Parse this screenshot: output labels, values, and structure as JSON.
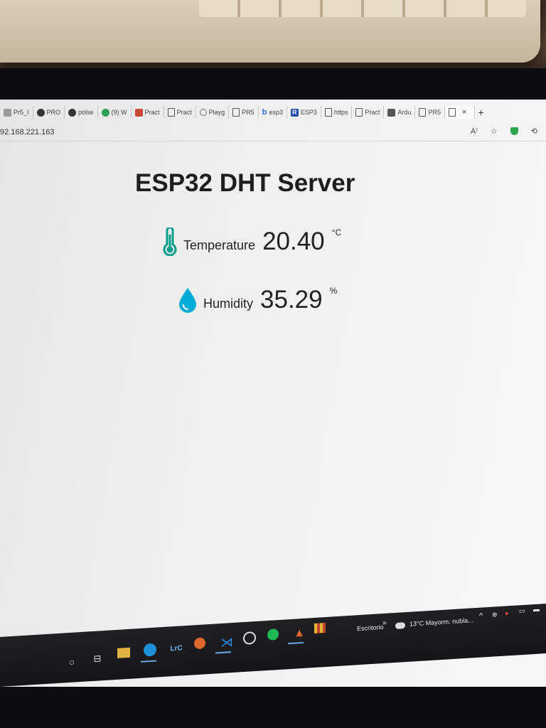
{
  "browser": {
    "tabs": [
      {
        "label": "Pr5_I",
        "favicon": "globe-icon"
      },
      {
        "label": "PRO",
        "favicon": "github-icon"
      },
      {
        "label": "polse",
        "favicon": "github-icon"
      },
      {
        "label": "(9) W",
        "favicon": "whatsapp-icon"
      },
      {
        "label": "Pract",
        "favicon": "pdf-icon"
      },
      {
        "label": "Pract",
        "favicon": "document-icon"
      },
      {
        "label": "Playg",
        "favicon": "openai-icon"
      },
      {
        "label": "PR5",
        "favicon": "document-icon"
      },
      {
        "label": "esp3",
        "favicon": "bing-icon"
      },
      {
        "label": "ESP3",
        "favicon": "r-icon"
      },
      {
        "label": "https",
        "favicon": "document-icon"
      },
      {
        "label": "Pract",
        "favicon": "document-icon"
      },
      {
        "label": "Ardu",
        "favicon": "arduino-icon"
      },
      {
        "label": "PR5",
        "favicon": "document-icon"
      }
    ],
    "close_glyph": "×",
    "new_tab_glyph": "+",
    "url": "92.168.221.163",
    "read_aloud_glyph": "A⁾",
    "favorites_glyph": "☆",
    "extension_glyph": "⟲"
  },
  "page": {
    "title": "ESP32 DHT Server",
    "accent_temperature": "#059e8a",
    "accent_humidity": "#00add6",
    "readings": {
      "temperature": {
        "label": "Temperature",
        "value": "20.40",
        "unit": "°C"
      },
      "humidity": {
        "label": "Humidity",
        "value": "35.29",
        "unit": "%"
      }
    }
  },
  "taskbar": {
    "desktop_label": "Escritorio",
    "desktop_chevron": "»",
    "weather": "13°C Mayorm. nubla...",
    "apps": [
      "start-icon",
      "task-view-icon",
      "file-explorer-icon",
      "edge-icon",
      "lightroom-icon",
      "firefox-dev-icon",
      "vscode-icon",
      "obs-icon",
      "spotify-icon",
      "matlab-icon",
      "app-grid-icon"
    ],
    "lrc_label": "LrC"
  }
}
